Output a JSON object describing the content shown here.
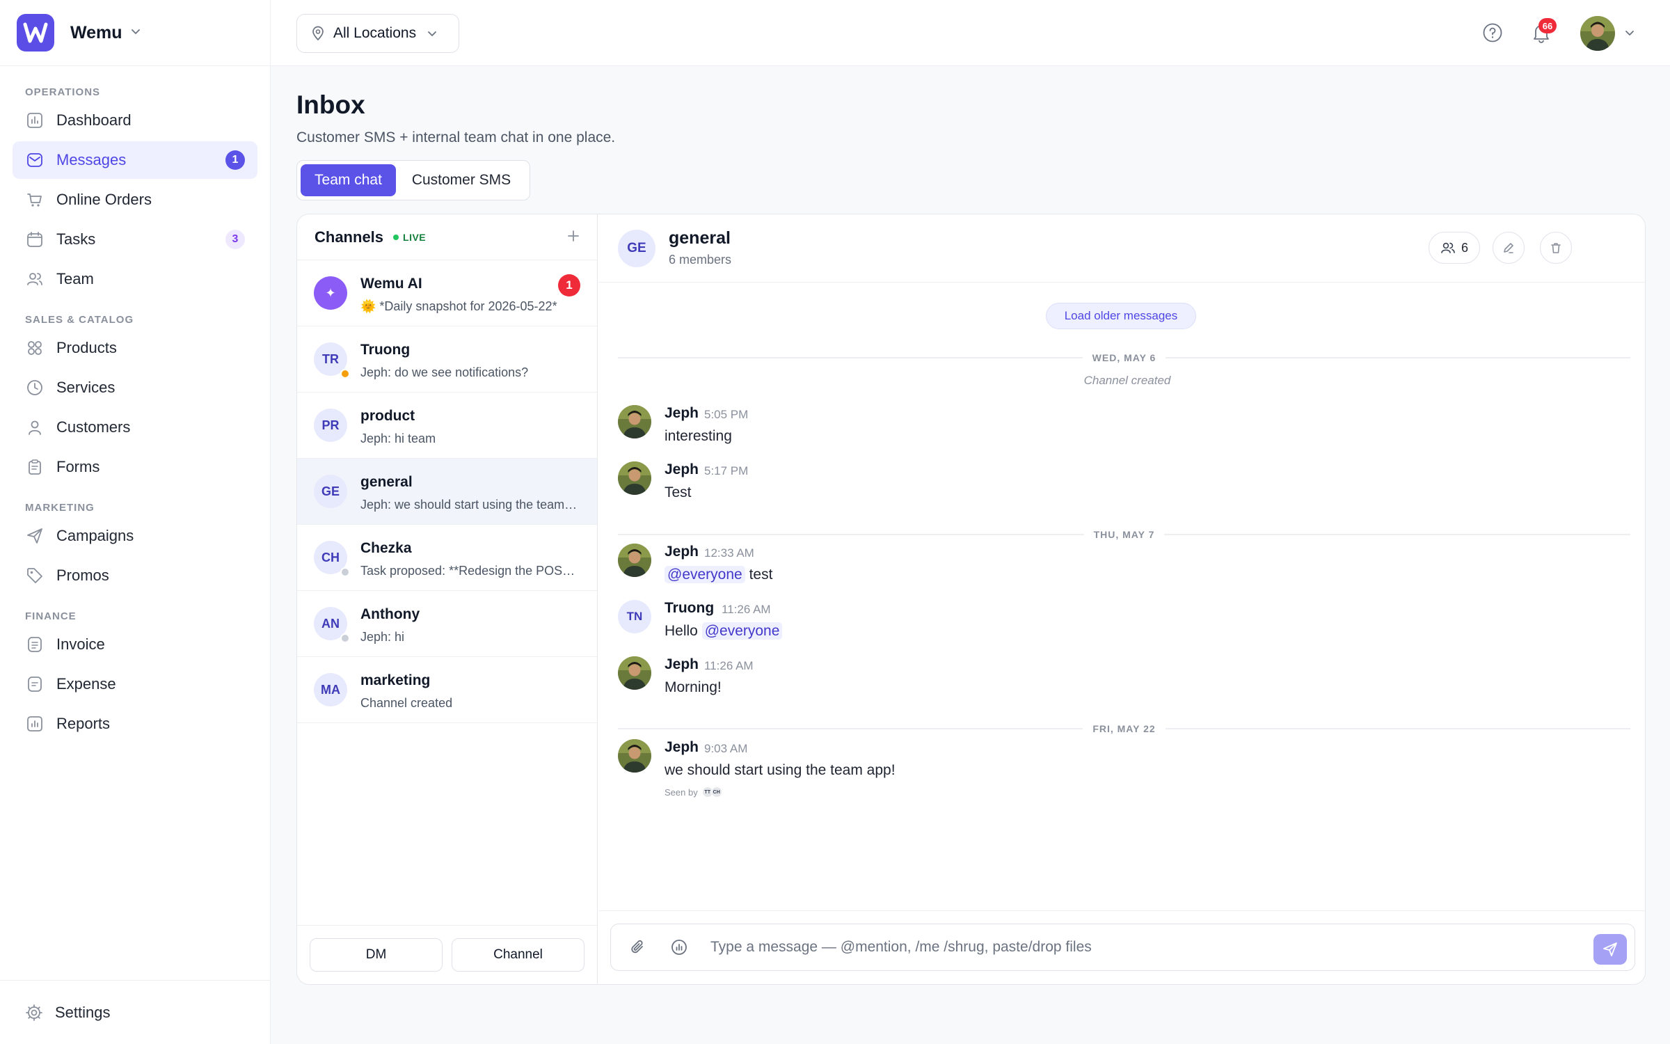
{
  "brand": {
    "name": "Wemu"
  },
  "sidebar": {
    "sections": [
      {
        "title": "OPERATIONS",
        "items": [
          {
            "label": "Dashboard",
            "icon": "dashboard-icon"
          },
          {
            "label": "Messages",
            "icon": "mail-icon",
            "badge": "1",
            "active": true
          },
          {
            "label": "Online Orders",
            "icon": "cart-icon"
          },
          {
            "label": "Tasks",
            "icon": "calendar-icon",
            "badge": "3"
          },
          {
            "label": "Team",
            "icon": "team-icon"
          }
        ]
      },
      {
        "title": "SALES & CATALOG",
        "items": [
          {
            "label": "Products",
            "icon": "grid-icon"
          },
          {
            "label": "Services",
            "icon": "clock-icon"
          },
          {
            "label": "Customers",
            "icon": "user-icon"
          },
          {
            "label": "Forms",
            "icon": "clipboard-icon"
          }
        ]
      },
      {
        "title": "MARKETING",
        "items": [
          {
            "label": "Campaigns",
            "icon": "send-icon"
          },
          {
            "label": "Promos",
            "icon": "tag-icon"
          }
        ]
      },
      {
        "title": "FINANCE",
        "items": [
          {
            "label": "Invoice",
            "icon": "invoice-icon"
          },
          {
            "label": "Expense",
            "icon": "expense-icon"
          },
          {
            "label": "Reports",
            "icon": "reports-icon"
          }
        ]
      }
    ],
    "settings_label": "Settings"
  },
  "topbar": {
    "location_label": "All Locations",
    "notification_count": "66"
  },
  "page": {
    "title": "Inbox",
    "subtitle": "Customer SMS + internal team chat in one place.",
    "tabs": [
      "Team chat",
      "Customer SMS"
    ]
  },
  "channels": {
    "header": "Channels",
    "live_label": "LIVE",
    "list": [
      {
        "initials": "✦",
        "name": "Wemu AI",
        "preview": "🌞 *Daily snapshot for 2026-05-22*",
        "unread": "1",
        "ai": true
      },
      {
        "initials": "TR",
        "name": "Truong",
        "preview": "Jeph: do we see notifications?",
        "presence": "away"
      },
      {
        "initials": "PR",
        "name": "product",
        "preview": "Jeph: hi team"
      },
      {
        "initials": "GE",
        "name": "general",
        "preview": "Jeph: we should start using the team app!",
        "active": true
      },
      {
        "initials": "CH",
        "name": "Chezka",
        "preview": "Task proposed: **Redesign the POS screen**",
        "presence": "off"
      },
      {
        "initials": "AN",
        "name": "Anthony",
        "preview": "Jeph: hi",
        "presence": "off"
      },
      {
        "initials": "MA",
        "name": "marketing",
        "preview": "Channel created"
      }
    ],
    "footer_buttons": [
      "DM",
      "Channel"
    ]
  },
  "chat": {
    "initials": "GE",
    "title": "general",
    "members_label": "6 members",
    "member_count": "6",
    "load_older_label": "Load older messages",
    "date_1": "WED, MAY 6",
    "system_note": "Channel created",
    "date_2": "THU, MAY 7",
    "date_3": "FRI, MAY 22",
    "messages": [
      {
        "author": "Jeph",
        "time": "5:05 PM",
        "text": "interesting"
      },
      {
        "author": "Jeph",
        "time": "5:17 PM",
        "text": "Test"
      },
      {
        "author": "Jeph",
        "time": "12:33 AM",
        "mention": "@everyone",
        "text": "test"
      },
      {
        "author": "Truong",
        "initials": "TN",
        "time": "11:26 AM",
        "text": "Hello",
        "mention": "@everyone"
      },
      {
        "author": "Jeph",
        "time": "11:26 AM",
        "text": "Morning!"
      },
      {
        "author": "Jeph",
        "time": "9:03 AM",
        "text": "we should start using the team app!"
      }
    ],
    "seen_label": "Seen by",
    "seen_by": [
      "TT",
      "CH"
    ],
    "composer_placeholder": "Type a message — @mention, /me /shrug, paste/drop files"
  },
  "colors": {
    "accent": "#5b52e8",
    "danger": "#ef2b3a",
    "live": "#22c55e"
  }
}
